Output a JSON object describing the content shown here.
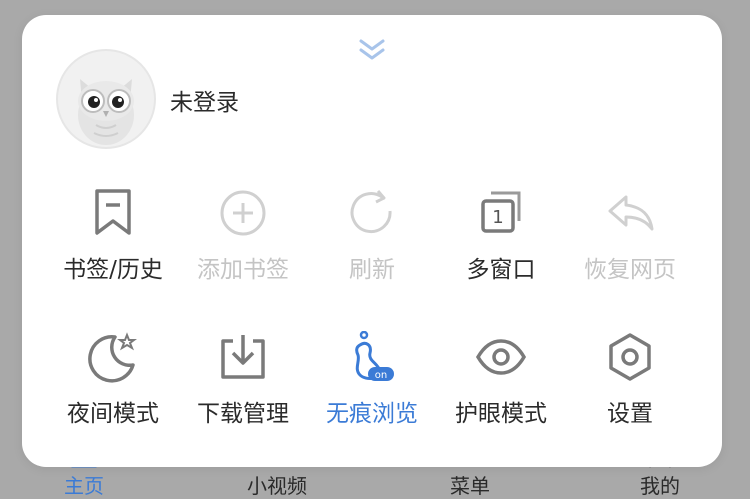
{
  "colors": {
    "backdrop": "#a9a9a9",
    "panel": "#ffffff",
    "text": "#2b2b2b",
    "disabled": "#c4c4c4",
    "accent": "#3b7bd6",
    "icon": "#7a7a7a",
    "handle": "#a8c4ea"
  },
  "panel": {
    "collapse_icon": "double-chevron-down-icon",
    "user": {
      "avatar_icon": "owl-avatar",
      "name": "未登录"
    },
    "menu_rows": [
      [
        {
          "label": "书签/历史",
          "icon": "bookmark-icon",
          "state": "enabled"
        },
        {
          "label": "添加书签",
          "icon": "plus-circle-icon",
          "state": "disabled"
        },
        {
          "label": "刷新",
          "icon": "refresh-icon",
          "state": "disabled"
        },
        {
          "label": "多窗口",
          "icon": "windows-icon",
          "state": "enabled",
          "badge": "1"
        },
        {
          "label": "恢复网页",
          "icon": "undo-arrow-icon",
          "state": "disabled"
        }
      ],
      [
        {
          "label": "夜间模式",
          "icon": "moon-star-icon",
          "state": "enabled"
        },
        {
          "label": "下载管理",
          "icon": "download-tray-icon",
          "state": "enabled"
        },
        {
          "label": "无痕浏览",
          "icon": "footprint-icon",
          "state": "active",
          "badge": "on"
        },
        {
          "label": "护眼模式",
          "icon": "eye-icon",
          "state": "enabled"
        },
        {
          "label": "设置",
          "icon": "hexagon-gear-icon",
          "state": "enabled"
        }
      ]
    ]
  },
  "bottom_nav": {
    "items": [
      {
        "label": "主页",
        "icon": "home-icon",
        "active": true
      },
      {
        "label": "小视频",
        "icon": "video-icon",
        "active": false
      },
      {
        "label": "菜单",
        "icon": "menu-icon",
        "active": false
      },
      {
        "label": "我的",
        "icon": "user-icon",
        "active": false
      }
    ]
  }
}
